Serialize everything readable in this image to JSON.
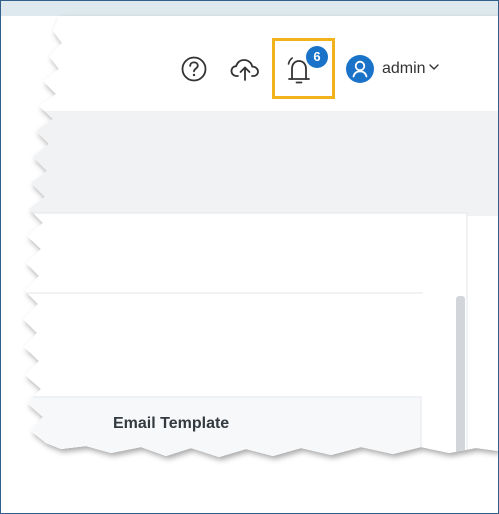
{
  "header": {
    "help_icon": "question-circle-icon",
    "upload_icon": "cloud-upload-icon",
    "notifications": {
      "icon": "bell-icon",
      "badge_count": "6",
      "highlighted": true,
      "highlight_color": "#f2b21b"
    },
    "user": {
      "avatar_icon": "user-icon",
      "name": "admin",
      "chevron_icon": "chevron-down-icon"
    }
  },
  "main": {
    "table_header_label": "Email Template"
  },
  "colors": {
    "accent": "#1a73c9",
    "frame_border": "#2f5f8a",
    "top_strip": "#dde9ee",
    "band": "#f0f2f4"
  }
}
